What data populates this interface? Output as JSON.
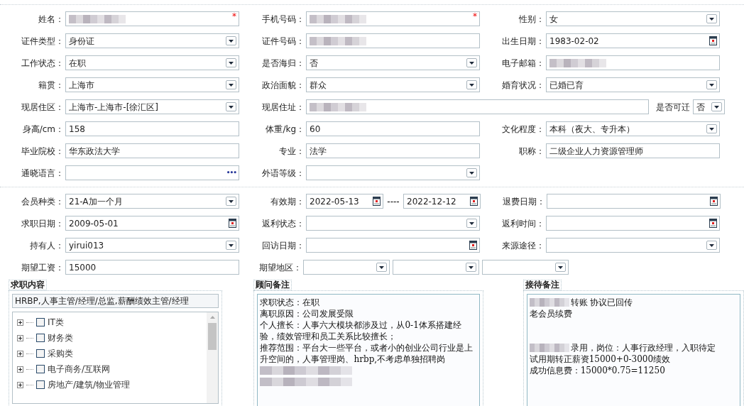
{
  "basic_rows": [
    [
      {
        "label": "姓名：",
        "kind": "text",
        "blurred": true,
        "required_mark": "*"
      },
      {
        "label": "手机号码：",
        "kind": "text",
        "blurred": true,
        "required_mark": "*"
      },
      {
        "label": "性别：",
        "kind": "select",
        "value": "女"
      }
    ],
    [
      {
        "label": "证件类型：",
        "kind": "select",
        "value": "身份证"
      },
      {
        "label": "证件号码：",
        "kind": "text",
        "blurred": true
      },
      {
        "label": "出生日期：",
        "kind": "date",
        "value": "1983-02-02"
      }
    ],
    [
      {
        "label": "工作状态：",
        "kind": "select",
        "value": "在职"
      },
      {
        "label": "是否海归：",
        "kind": "select",
        "value": "否"
      },
      {
        "label": "电子邮箱：",
        "kind": "text",
        "blurred": true
      }
    ],
    [
      {
        "label": "籍贯：",
        "kind": "select",
        "value": "上海市"
      },
      {
        "label": "政治面貌：",
        "kind": "select",
        "value": "群众"
      },
      {
        "label": "婚育状况：",
        "kind": "select",
        "value": "已婚已育"
      }
    ],
    [
      {
        "label": "现居住区：",
        "kind": "select",
        "value": "上海市-上海市-[徐汇区]"
      },
      {
        "label": "现居住址：",
        "kind": "wide",
        "blurred": true
      },
      {
        "label": "是否可迁",
        "kind": "mini",
        "value": "否"
      }
    ],
    [
      {
        "label": "身高/cm：",
        "kind": "text",
        "value": "158"
      },
      {
        "label": "体重/kg：",
        "kind": "text",
        "value": "60"
      },
      {
        "label": "文化程度：",
        "kind": "select",
        "value": "本科（夜大、专升本）"
      }
    ],
    [
      {
        "label": "毕业院校：",
        "kind": "text",
        "value": "华东政法大学"
      },
      {
        "label": "专业：",
        "kind": "text",
        "value": "法学"
      },
      {
        "label": "职称：",
        "kind": "text",
        "value": "二级企业人力资源管理师"
      }
    ],
    [
      {
        "label": "通晓语言：",
        "kind": "lookup",
        "lookup_symbol": "•••"
      },
      {
        "label": "外语等级：",
        "kind": "select"
      }
    ]
  ],
  "member_rows": [
    [
      {
        "label": "会员种类：",
        "kind": "select",
        "value": "21-A加一个月"
      },
      {
        "label": "有效期：",
        "kind": "range",
        "value": "2022-05-13",
        "separator": "----",
        "value_end": "2022-12-12"
      },
      {
        "label": "退费日期：",
        "kind": "date"
      }
    ],
    [
      {
        "label": "求职日期：",
        "kind": "date",
        "value": "2009-05-01"
      },
      {
        "label": "返利状态：",
        "kind": "select"
      },
      {
        "label": "返利时间：",
        "kind": "date"
      }
    ],
    [
      {
        "label": "持有人：",
        "kind": "select",
        "value": "yirui013"
      },
      {
        "label": "回访日期：",
        "kind": "date"
      },
      {
        "label": "来源途径：",
        "kind": "select"
      }
    ],
    [
      {
        "label": "期望工资：",
        "kind": "text",
        "value": "15000"
      },
      {
        "label": "期望地区：",
        "kind": "triple"
      }
    ]
  ],
  "job_intent": {
    "title": "求职内容",
    "value": "HRBP,人事主管/经理/总监,薪酬绩效主管/经理",
    "categories": [
      {
        "label": "IT类",
        "checked": false
      },
      {
        "label": "财务类",
        "checked": false
      },
      {
        "label": "采购类",
        "checked": false
      },
      {
        "label": "电子商务/互联网",
        "checked": false
      },
      {
        "label": "房地产/建筑/物业管理",
        "checked": false
      }
    ]
  },
  "consultant_notes": {
    "title": "顾问备注",
    "lines": [
      {
        "kind": "text",
        "text": "求职状态：在职"
      },
      {
        "kind": "text",
        "text": "离职原因：公司发展受限"
      },
      {
        "kind": "text",
        "text": "个人擅长：人事六大模块都涉及过，从0-1体系搭建经验，绩效管理和员工关系比较擅长；"
      },
      {
        "kind": "text",
        "text": "推荐范围：平台大一些平台，或者小的创业公司行业是上升空间的，人事管理岗、hrbp,不考虑单独招聘岗"
      },
      {
        "kind": "blurred"
      },
      {
        "kind": "blurred"
      }
    ]
  },
  "reception_notes": {
    "title": "接待备注",
    "lines": [
      {
        "kind": "blurred_prefix",
        "text": "转账 协议已回传"
      },
      {
        "kind": "text",
        "text": "老会员续费"
      },
      {
        "kind": "blank"
      },
      {
        "kind": "blank"
      },
      {
        "kind": "blurred_prefix",
        "text": "录用，岗位：人事行政经理，入职待定"
      },
      {
        "kind": "text",
        "text": "试用期转正薪资15000+0-3000绩效"
      },
      {
        "kind": "text",
        "text": "成功信息费：15000*0.75=11250"
      }
    ]
  }
}
